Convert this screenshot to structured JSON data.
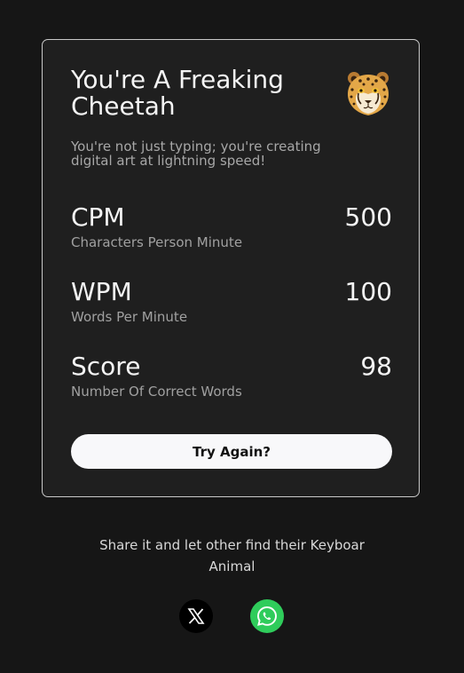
{
  "result": {
    "title": "You're A Freaking Cheetah",
    "subtitle": "You're not just typing; you're creating digital art at lightning speed!",
    "animal_icon": "cheetah-face-icon",
    "stats": [
      {
        "name": "CPM",
        "description": "Characters Person Minute",
        "value": "500"
      },
      {
        "name": "WPM",
        "description": "Words Per Minute",
        "value": "100"
      },
      {
        "name": "Score",
        "description": "Number Of Correct Words",
        "value": "98"
      }
    ],
    "try_again_label": "Try Again?"
  },
  "share": {
    "text": "Share it and let other find their Keyboar Animal",
    "buttons": [
      {
        "icon": "x-logo-icon",
        "color": "#000000"
      },
      {
        "icon": "whatsapp-icon",
        "color": "#2fcc5b"
      }
    ]
  },
  "colors": {
    "background": "#161616",
    "card": "#1f1f1f",
    "card_border": "#c9c9c9",
    "button": "#f8f8fa"
  }
}
